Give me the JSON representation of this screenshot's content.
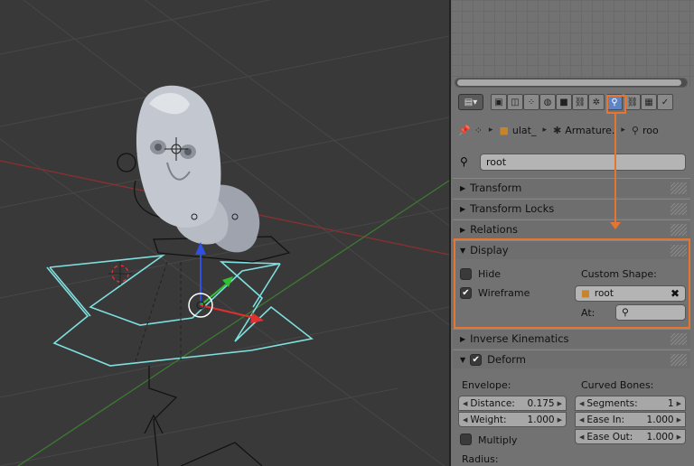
{
  "breadcrumb": {
    "items": [
      {
        "icon": "pin-icon",
        "label": ""
      },
      {
        "icon": "scene-icon",
        "label": ""
      },
      {
        "icon": "object-cube-icon",
        "label": "ulat_"
      },
      {
        "icon": "armature-icon",
        "label": "Armature."
      },
      {
        "icon": "bone-icon",
        "label": "roo"
      }
    ]
  },
  "bone_name": "root",
  "panels": {
    "transform": "Transform",
    "transform_locks": "Transform Locks",
    "relations": "Relations",
    "display": "Display",
    "inverse_kinematics": "Inverse Kinematics",
    "deform": "Deform"
  },
  "display": {
    "hide_label": "Hide",
    "hide_checked": false,
    "wireframe_label": "Wireframe",
    "wireframe_checked": true,
    "custom_shape_label": "Custom Shape:",
    "custom_shape_value": "root",
    "at_label": "At:"
  },
  "deform": {
    "enabled": true,
    "envelope_label": "Envelope:",
    "distance_label": "Distance:",
    "distance_value": "0.175",
    "weight_label": "Weight:",
    "weight_value": "1.000",
    "multiply_label": "Multiply",
    "radius_label": "Radius:",
    "curved_bones_label": "Curved Bones:",
    "segments_label": "Segments:",
    "segments_value": "1",
    "ease_in_label": "Ease In:",
    "ease_in_value": "1.000",
    "ease_out_label": "Ease Out:",
    "ease_out_value": "1.000"
  },
  "colors": {
    "highlight": "#e8752f",
    "active_tab": "#5e84c4",
    "gizmo_x": "#e03030",
    "gizmo_y": "#30c030",
    "gizmo_z": "#3050e0",
    "bone_shape": "#7fe0e0"
  },
  "property_tabs": [
    "render-icon",
    "render-layers-icon",
    "scene-icon",
    "world-icon",
    "object-icon",
    "constraints-icon",
    "modifiers-icon",
    "data-icon",
    "bone-icon",
    "bone-constraints-icon",
    "material-icon",
    "texture-icon"
  ],
  "active_tab": "bone-icon"
}
